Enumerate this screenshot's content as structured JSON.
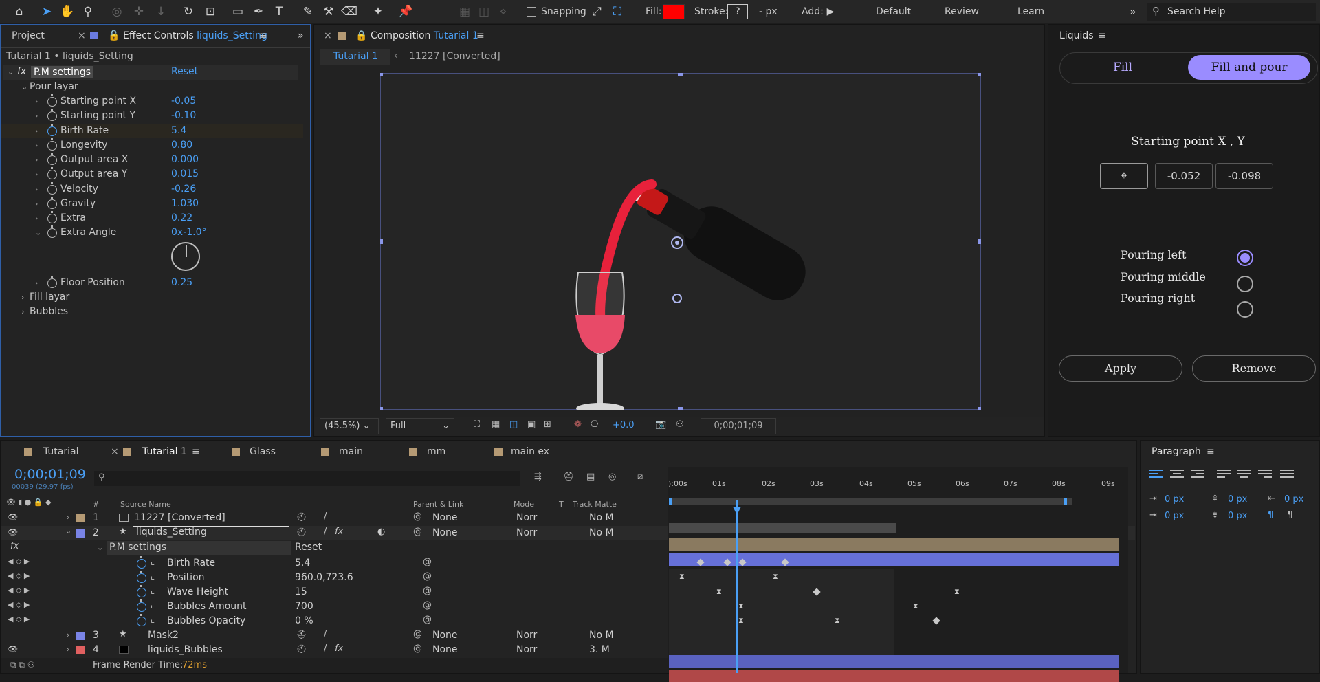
{
  "toolbar": {
    "snapping_label": "Snapping",
    "fill_label": "Fill:",
    "fill_color": "#ff0000",
    "stroke_label": "Stroke:",
    "stroke_value": "?",
    "stroke_unit": "- px",
    "add_label": "Add:",
    "workspaces": [
      "Default",
      "Review",
      "Learn"
    ],
    "search_placeholder": "Search Help"
  },
  "effect_controls": {
    "tab_project": "Project",
    "tab_label": "Effect Controls",
    "tab_layer": "liquids_Setting",
    "breadcrumb": "Tutarial 1 • liquids_Setting",
    "effect_name": "P.M settings",
    "reset": "Reset",
    "group_pour": "Pour layar",
    "props": [
      {
        "label": "Starting point X",
        "value": "-0.05"
      },
      {
        "label": "Starting point Y",
        "value": "-0.10"
      },
      {
        "label": "Birth Rate",
        "value": "5.4"
      },
      {
        "label": "Longevity",
        "value": "0.80"
      },
      {
        "label": "Output area X",
        "value": "0.000"
      },
      {
        "label": "Output area Y",
        "value": "0.015"
      },
      {
        "label": "Velocity",
        "value": "-0.26"
      },
      {
        "label": "Gravity",
        "value": "1.030"
      },
      {
        "label": "Extra",
        "value": "0.22"
      },
      {
        "label": "Extra Angle",
        "value": "0x-1.0°"
      }
    ],
    "floor_label": "Floor Position",
    "floor_value": "0.25",
    "group_fill": "Fill layar",
    "group_bubbles": "Bubbles"
  },
  "composition": {
    "tab_label": "Composition",
    "tab_name": "Tutarial 1",
    "crumb_active": "Tutarial 1",
    "crumb_other": "11227 [Converted]",
    "zoom": "(45.5%)",
    "resolution": "Full",
    "exposure": "+0.0",
    "timecode": "0;00;01;09"
  },
  "liquids": {
    "panel_title": "Liquids",
    "tab_fill": "Fill",
    "tab_fill_pour": "Fill and pour",
    "starting_title": "Starting point X , Y",
    "x_value": "-0.052",
    "y_value": "-0.098",
    "pour_options": [
      "Pouring left",
      "Pouring middle",
      "Pouring right"
    ],
    "selected_option": "Pouring left",
    "accent": "#9a8cff",
    "apply": "Apply",
    "remove": "Remove"
  },
  "timeline": {
    "tabs": [
      "Tutarial",
      "Tutarial 1",
      "Glass",
      "main",
      "mm",
      "main ex"
    ],
    "timecode": "0;00;01;09",
    "frame_info": "00039 (29.97 fps)",
    "columns": {
      "source": "Source Name",
      "parent": "Parent & Link",
      "mode": "Mode",
      "t": "T",
      "track": "Track Matte"
    },
    "ruler": [
      "):00s",
      "01s",
      "02s",
      "03s",
      "04s",
      "05s",
      "06s",
      "07s",
      "08s",
      "09s"
    ],
    "layers": [
      {
        "num": "1",
        "name": "11227 [Converted]",
        "parent": "None",
        "mode": "Norr",
        "track": "No M",
        "color": "#b59a74"
      },
      {
        "num": "2",
        "name": "liquids_Setting",
        "parent": "None",
        "mode": "Norr",
        "track": "No M",
        "color": "#7a84e6"
      },
      {
        "num": "3",
        "name": "Mask2",
        "parent": "None",
        "mode": "Norr",
        "track": "No M",
        "color": "#7a84e6"
      },
      {
        "num": "4",
        "name": "liquids_Bubbles",
        "parent": "None",
        "mode": "Norr",
        "track": "3. M",
        "color": "#e06060"
      }
    ],
    "effect_group": "P.M settings",
    "effect_reset": "Reset",
    "effect_props": [
      {
        "label": "Birth Rate",
        "value": "5.4"
      },
      {
        "label": "Position",
        "value": "960.0,723.6"
      },
      {
        "label": "Wave Height",
        "value": "15"
      },
      {
        "label": "Bubbles Amount",
        "value": "700"
      },
      {
        "label": "Bubbles Opacity",
        "value": "0 %"
      }
    ],
    "render_label": "Frame Render Time:",
    "render_value": "72ms"
  },
  "paragraph": {
    "title": "Paragraph",
    "indent_values": [
      "0 px",
      "0 px",
      "0 px",
      "0 px",
      "0 px"
    ]
  }
}
